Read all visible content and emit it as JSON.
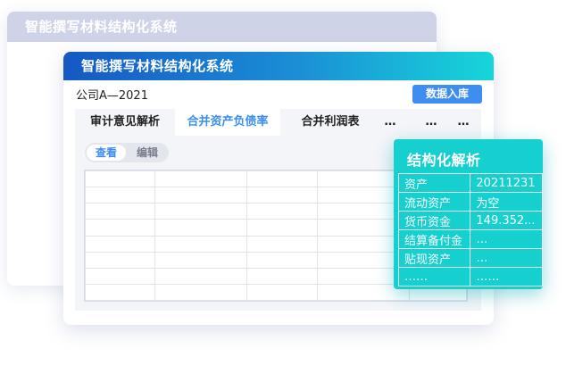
{
  "back_window": {
    "title": "智能撰写材料结构化系统"
  },
  "main_window": {
    "title": "智能撰写材料结构化系统",
    "company": "公司A—2021",
    "import_button": "数据入库",
    "tabs": [
      {
        "label": "审计意见解析"
      },
      {
        "label": "合并资产负债率",
        "active": true
      },
      {
        "label": "合并利润表"
      },
      {
        "label": "…"
      },
      {
        "label": "…"
      },
      {
        "label": "…"
      }
    ],
    "view_toggle": {
      "view": "查看",
      "edit": "编辑"
    }
  },
  "analysis_card": {
    "title": "结构化解析",
    "rows": [
      {
        "key": "资产",
        "value": "20211231"
      },
      {
        "key": "流动资产",
        "value": "为空"
      },
      {
        "key": "货币资金",
        "value": "149.352..."
      },
      {
        "key": "结算备付金",
        "value": "…"
      },
      {
        "key": "贴现资产",
        "value": "…"
      },
      {
        "key": "……",
        "value": "……"
      }
    ]
  }
}
